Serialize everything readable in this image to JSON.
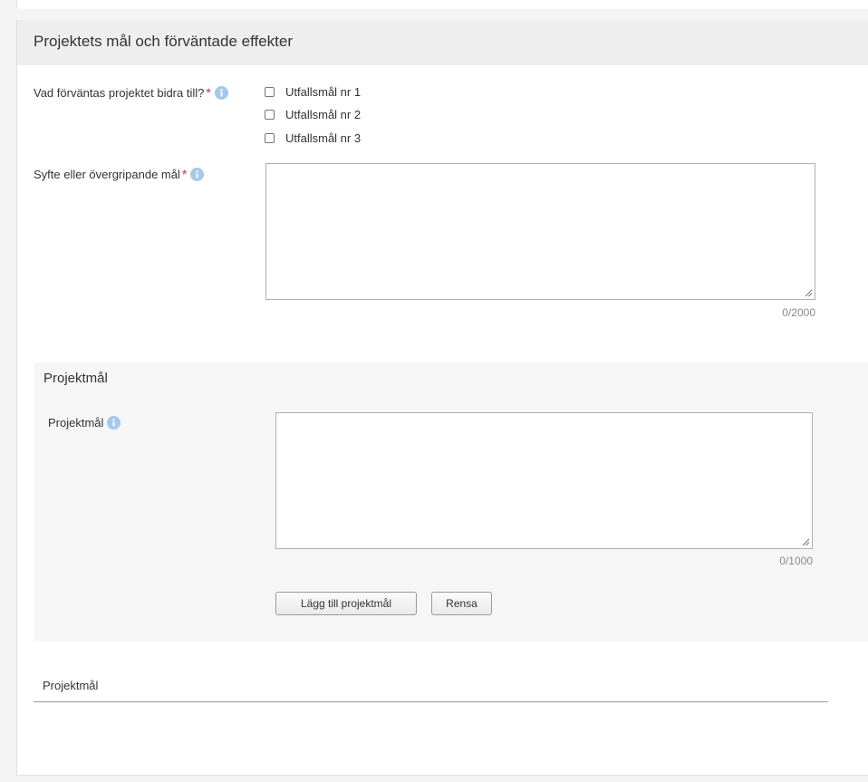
{
  "section": {
    "title": "Projektets mål och förväntade effekter"
  },
  "contribution": {
    "label": "Vad förväntas projektet bidra till?",
    "required_mark": "*",
    "options": [
      {
        "label": "Utfallsmål nr 1",
        "checked": false
      },
      {
        "label": "Utfallsmål nr 2",
        "checked": false
      },
      {
        "label": "Utfallsmål nr 3",
        "checked": false
      }
    ]
  },
  "purpose": {
    "label": "Syfte eller övergripande mål",
    "required_mark": "*",
    "value": "",
    "counter": "0/2000"
  },
  "project_goal_form": {
    "title": "Projektmål",
    "field_label": "Projektmål",
    "value": "",
    "counter": "0/1000",
    "add_button": "Lägg till projektmål",
    "clear_button": "Rensa"
  },
  "project_goal_list": {
    "title": "Projektmål"
  },
  "colors": {
    "required": "#e0245e",
    "info_icon": "#a6c8ec",
    "header_bg": "#eeeeee",
    "subpanel_bg": "#f6f6f6"
  }
}
